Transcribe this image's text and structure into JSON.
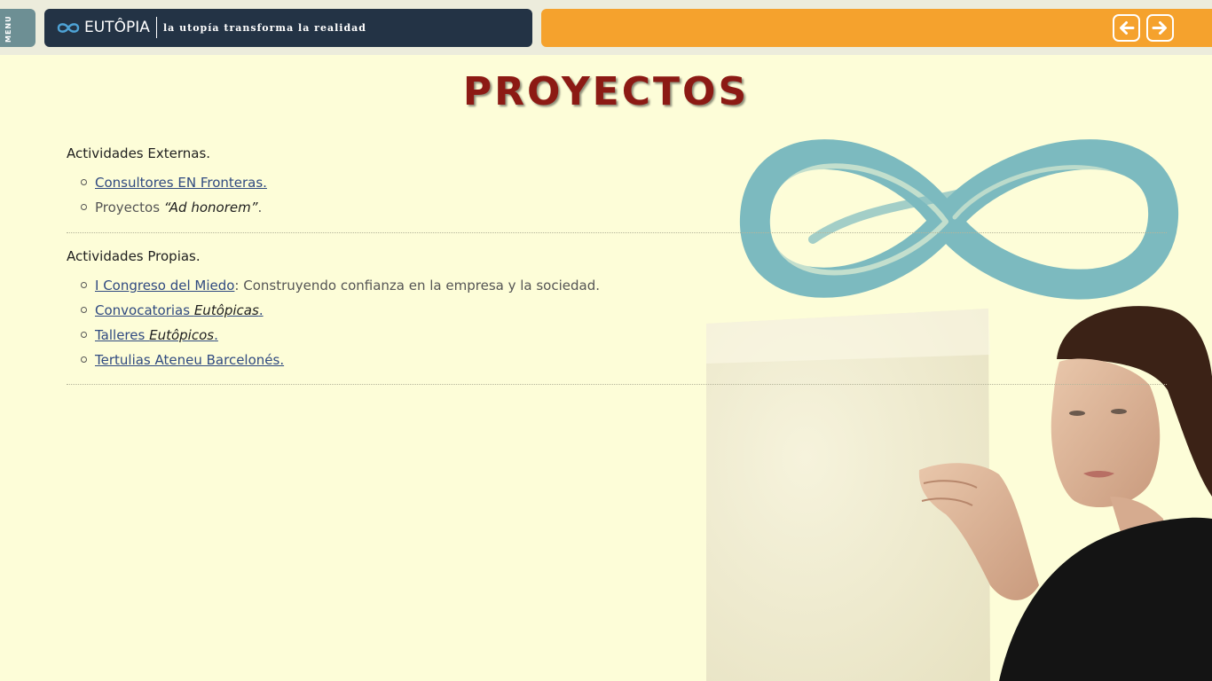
{
  "menu": {
    "label": "MENU"
  },
  "brand": {
    "name": "EUTÔPIA",
    "tagline": "la utopía transforma la realidad"
  },
  "nav": {
    "prev_icon": "arrow-left-icon",
    "next_icon": "arrow-right-icon"
  },
  "page": {
    "title": "PROYECTOS"
  },
  "sections": [
    {
      "heading": "Actividades Externas.",
      "items": [
        {
          "link": "Consultores EN Fronteras."
        },
        {
          "text": "Proyectos ",
          "emph": "“Ad honorem”",
          "suffix": "."
        }
      ]
    },
    {
      "heading": "Actividades Propias.",
      "items": [
        {
          "link": "I Congreso del Miedo",
          "suffix": ": Construyendo confianza en la empresa y la sociedad."
        },
        {
          "link": "Convocatorias ",
          "link_emph": "Eutôpicas",
          "link_suffix": "."
        },
        {
          "link": "Talleres ",
          "link_emph": "Eutôpicos",
          "link_suffix": "."
        },
        {
          "link": "Tertulias Ateneu Barcelonés."
        }
      ]
    }
  ],
  "colors": {
    "background": "#fdfdd8",
    "brand_bar": "#233345",
    "nav_bar": "#f5a22d",
    "menu_tab": "#6d8f94",
    "title": "#8c1a14",
    "link": "#304a80",
    "infinity_logo": "#6fb3bd"
  }
}
